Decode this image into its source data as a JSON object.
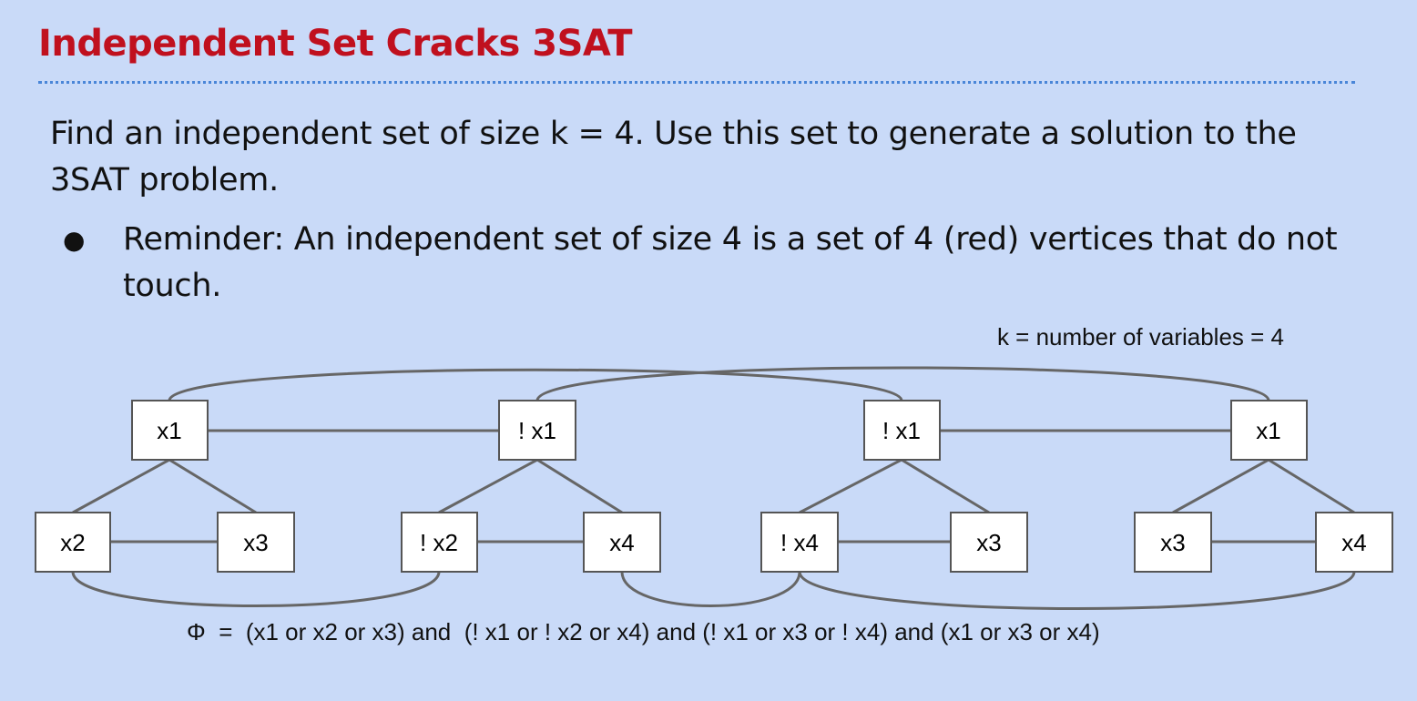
{
  "slide": {
    "title": "Independent Set Cracks 3SAT",
    "body": "Find an independent set of size k = 4. Use this set to generate a solution to the 3SAT problem.",
    "bullets": [
      "Reminder: An independent set of size 4 is a set of 4 (red) vertices that do not touch."
    ],
    "bullet_glyph": "●"
  },
  "diagram": {
    "k_label": "k = number of variables = 4",
    "formula": "Φ  =  (x1 or x2 or x3) and  (! x1 or ! x2 or x4) and (! x1 or x3 or ! x4) and (x1 or x3 or x4)",
    "nodes": {
      "c1_top": "x1",
      "c1_left": "x2",
      "c1_right": "x3",
      "c2_top": "! x1",
      "c2_left": "! x2",
      "c2_right": "x4",
      "c3_top": "! x1",
      "c3_left": "! x4",
      "c3_right": "x3",
      "c4_top": "x1",
      "c4_left": "x3",
      "c4_right": "x4"
    }
  },
  "colors": {
    "background": "#c9daf8",
    "title": "#c0101e",
    "divider": "#4a86d8",
    "edge": "#666666"
  }
}
